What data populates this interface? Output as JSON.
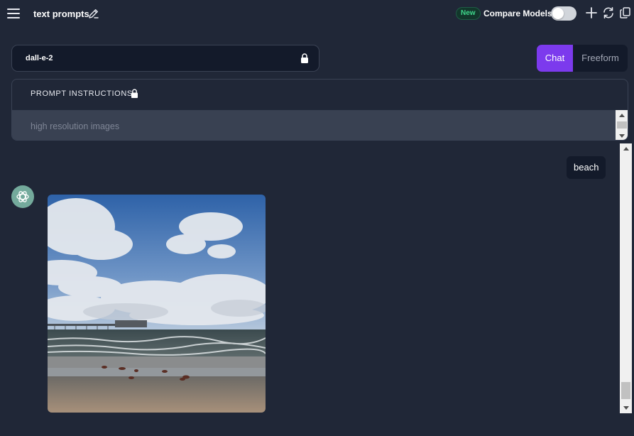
{
  "header": {
    "title": "text prompts",
    "new_badge": "New",
    "compare_label": "Compare Models",
    "compare_enabled": false
  },
  "model_select": {
    "value": "dall-e-2",
    "icon": "lock-icon"
  },
  "mode_tabs": [
    {
      "label": "Chat",
      "active": true
    },
    {
      "label": "Freeform",
      "active": false
    }
  ],
  "prompt_instructions": {
    "header": "PROMPT INSTRUCTIONS",
    "text": "high resolution images"
  },
  "chat": {
    "messages": [
      {
        "role": "user",
        "text": "beach"
      },
      {
        "role": "assistant",
        "type": "image",
        "icon": "openai-logo-icon"
      }
    ]
  },
  "colors": {
    "background": "#202737",
    "accent": "#7c3aed",
    "badge_green": "#3fd68b",
    "avatar": "#74aa9c"
  }
}
